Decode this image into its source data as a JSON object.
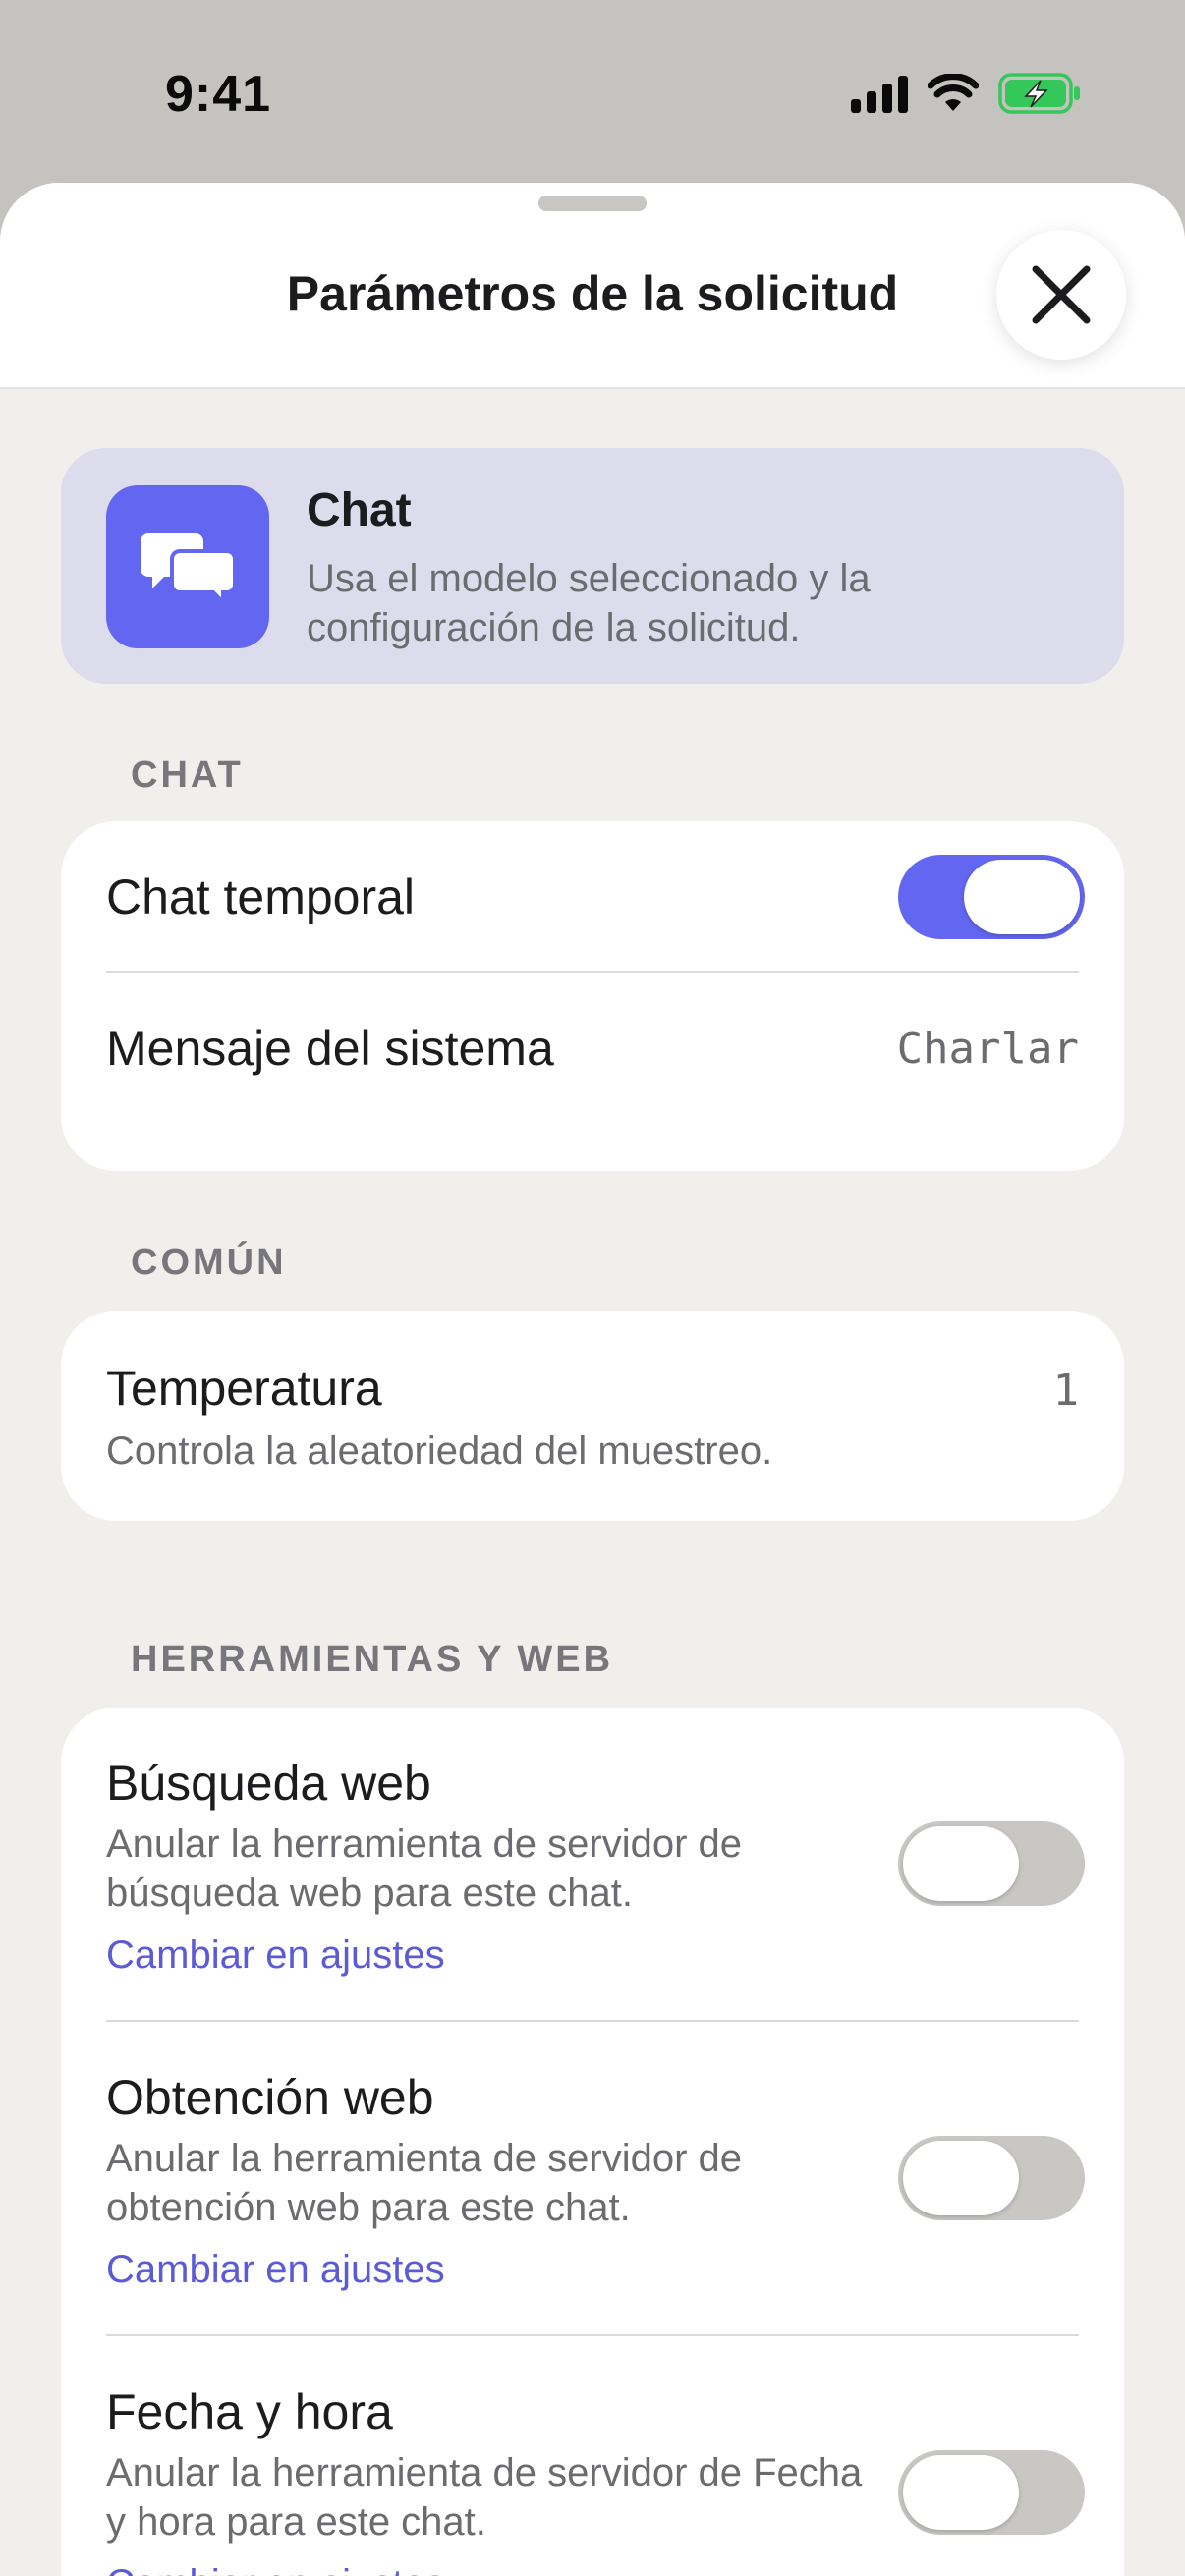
{
  "status_bar": {
    "time": "9:41"
  },
  "sheet": {
    "title": "Parámetros de la solicitud"
  },
  "mode": {
    "title": "Chat",
    "description": "Usa el modelo seleccionado y la configuración de la solicitud.",
    "accent_color": "#6366f1",
    "icon": "chat-bubbles-icon"
  },
  "sections": {
    "chat": {
      "label": "CHAT",
      "temporary_chat": {
        "label": "Chat temporal",
        "enabled": true
      },
      "system_message": {
        "label": "Mensaje del sistema",
        "value": "Charlar"
      }
    },
    "common": {
      "label": "COMÚN",
      "temperature": {
        "label": "Temperatura",
        "description": "Controla la aleatoriedad del muestreo.",
        "value": "1"
      }
    },
    "tools": {
      "label": "HERRAMIENTAS Y WEB",
      "items": [
        {
          "title": "Búsqueda web",
          "description": "Anular la herramienta de servidor de búsqueda web para este chat.",
          "link": "Cambiar en ajustes",
          "enabled": false
        },
        {
          "title": "Obtención web",
          "description": "Anular la herramienta de servidor de obtención web para este chat.",
          "link": "Cambiar en ajustes",
          "enabled": false
        },
        {
          "title": "Fecha y hora",
          "description": "Anular la herramienta de servidor de Fecha y hora para este chat.",
          "link": "Cambiar en ajustes",
          "enabled": false
        }
      ]
    }
  },
  "colors": {
    "link": "#5b5bd6",
    "toggle_on": "#6366f1",
    "toggle_off": "#c8c7c4",
    "battery": "#34c759"
  }
}
